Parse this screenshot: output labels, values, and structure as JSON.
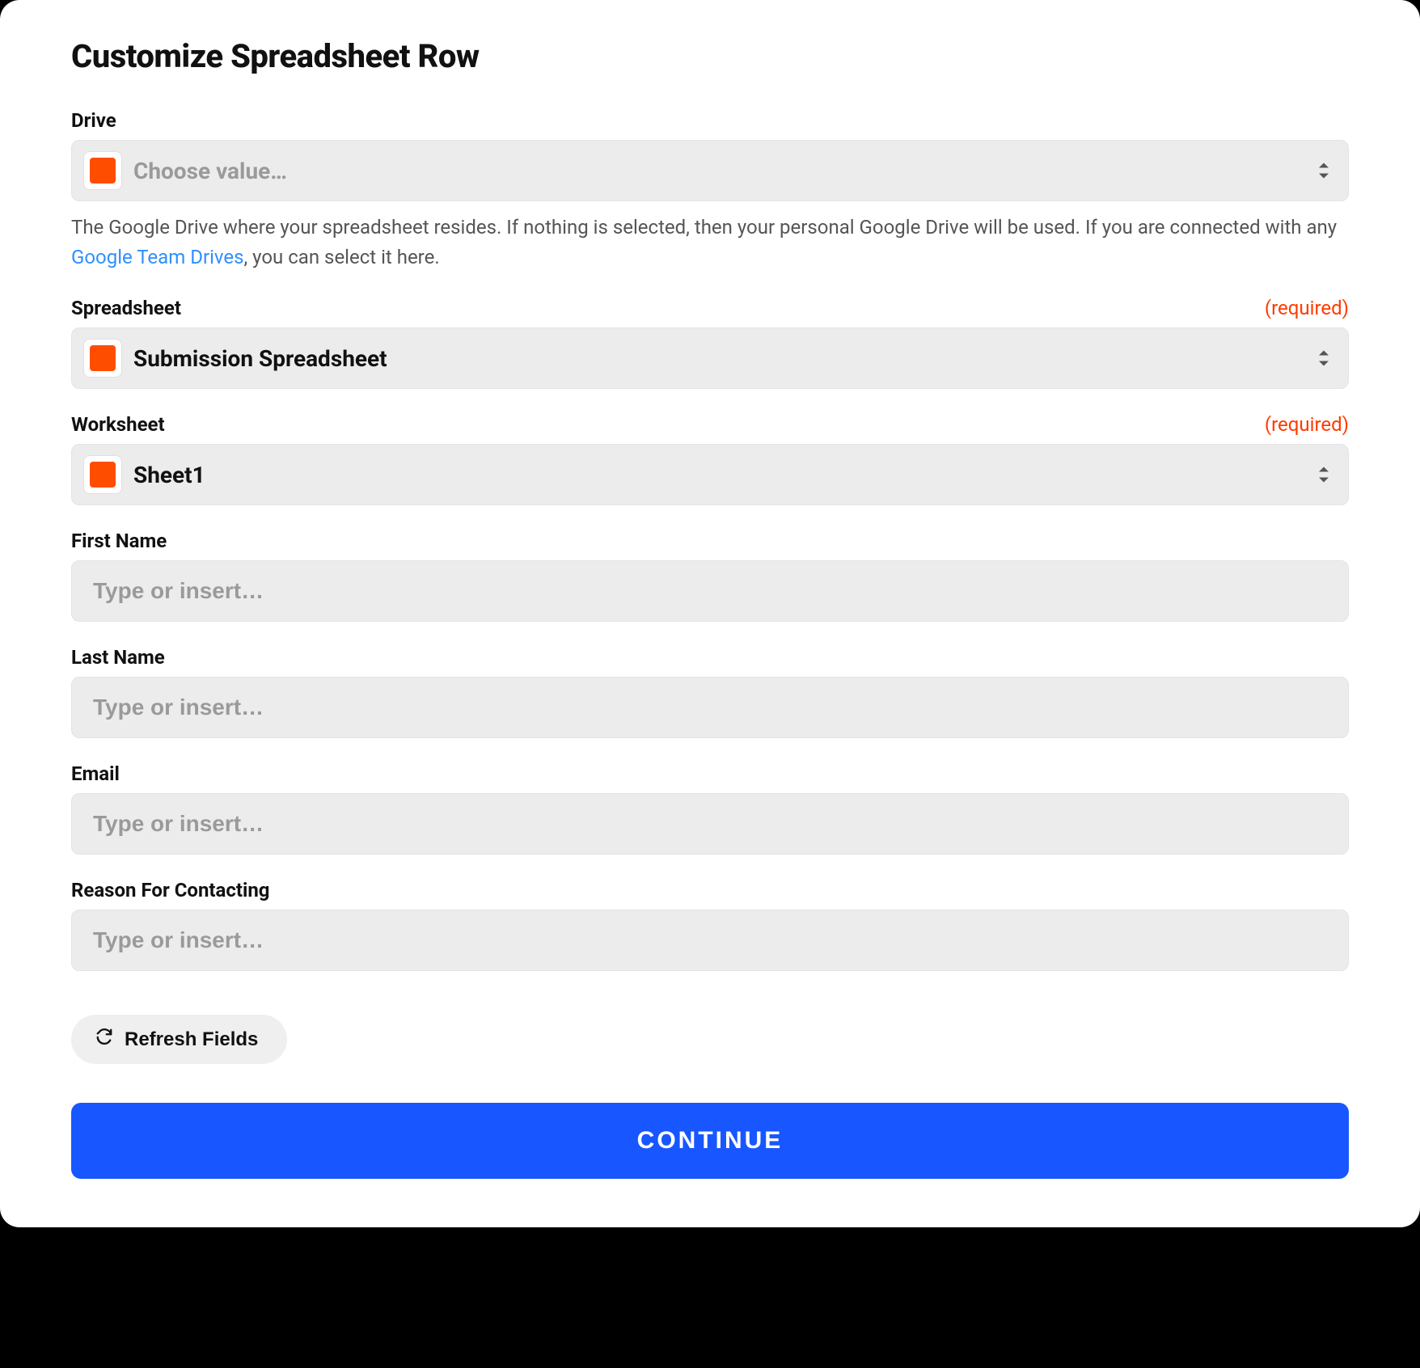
{
  "title": "Customize Spreadsheet Row",
  "required_label": "(required)",
  "drive": {
    "label": "Drive",
    "placeholder": "Choose value…",
    "help_pre": "The Google Drive where your spreadsheet resides. If nothing is selected, then your personal Google Drive will be used. If you are connected with any ",
    "help_link": "Google Team Drives",
    "help_post": ", you can select it here."
  },
  "spreadsheet": {
    "label": "Spreadsheet",
    "value": "Submission Spreadsheet"
  },
  "worksheet": {
    "label": "Worksheet",
    "value": "Sheet1"
  },
  "fields": {
    "first_name": {
      "label": "First Name",
      "placeholder": "Type or insert…"
    },
    "last_name": {
      "label": "Last Name",
      "placeholder": "Type or insert…"
    },
    "email": {
      "label": "Email",
      "placeholder": "Type or insert…"
    },
    "reason": {
      "label": "Reason For Contacting",
      "placeholder": "Type or insert…"
    }
  },
  "refresh_label": "Refresh Fields",
  "continue_label": "CONTINUE"
}
